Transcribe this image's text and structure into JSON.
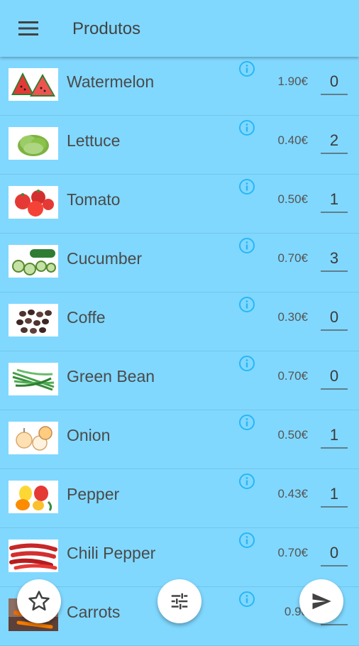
{
  "app_bar": {
    "title": "Produtos",
    "menu_icon": "menu-icon"
  },
  "products": [
    {
      "name": "Watermelon",
      "price": "1.90€",
      "quantity": "0",
      "image": "watermelon-image"
    },
    {
      "name": "Lettuce",
      "price": "0.40€",
      "quantity": "2",
      "image": "lettuce-image"
    },
    {
      "name": "Tomato",
      "price": "0.50€",
      "quantity": "1",
      "image": "tomato-image"
    },
    {
      "name": "Cucumber",
      "price": "0.70€",
      "quantity": "3",
      "image": "cucumber-image"
    },
    {
      "name": "Coffe",
      "price": "0.30€",
      "quantity": "0",
      "image": "coffee-beans-image"
    },
    {
      "name": "Green Bean",
      "price": "0.70€",
      "quantity": "0",
      "image": "green-bean-image"
    },
    {
      "name": "Onion",
      "price": "0.50€",
      "quantity": "1",
      "image": "onion-image"
    },
    {
      "name": "Pepper",
      "price": "0.43€",
      "quantity": "1",
      "image": "pepper-image"
    },
    {
      "name": "Chili Pepper",
      "price": "0.70€",
      "quantity": "0",
      "image": "chili-pepper-image"
    },
    {
      "name": "Carrots",
      "price": "0.90",
      "quantity": "",
      "image": "carrots-image"
    }
  ],
  "fabs": {
    "favorites_icon": "star-outline-icon",
    "filter_icon": "tune-sliders-icon",
    "send_icon": "send-icon"
  },
  "colors": {
    "background": "#80d8ff",
    "info_icon": "#29b6f6",
    "text": "#4a4a4a"
  }
}
